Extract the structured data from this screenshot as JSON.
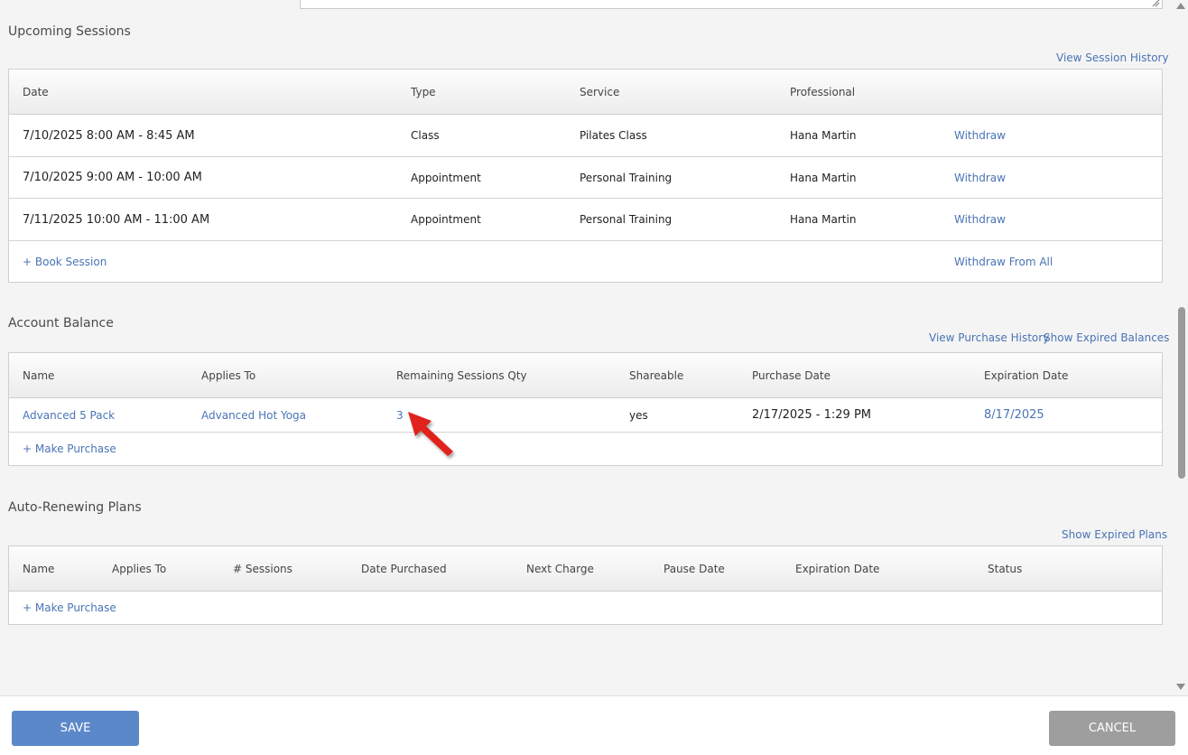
{
  "upcoming": {
    "title": "Upcoming Sessions",
    "history_link": "View Session History",
    "columns": [
      "Date",
      "Type",
      "Service",
      "Professional"
    ],
    "rows": [
      {
        "date": "7/10/2025 8:00 AM - 8:45 AM",
        "type": "Class",
        "service": "Pilates Class",
        "professional": "Hana Martin",
        "action": "Withdraw"
      },
      {
        "date": "7/10/2025 9:00 AM - 10:00 AM",
        "type": "Appointment",
        "service": "Personal Training",
        "professional": "Hana Martin",
        "action": "Withdraw"
      },
      {
        "date": "7/11/2025 10:00 AM - 11:00 AM",
        "type": "Appointment",
        "service": "Personal Training",
        "professional": "Hana Martin",
        "action": "Withdraw"
      }
    ],
    "book_link": "+ Book Session",
    "withdraw_all_link": "Withdraw From All"
  },
  "balance": {
    "title": "Account Balance",
    "purchase_history_link": "View Purchase History",
    "expired_link": "Show Expired Balances",
    "columns": [
      "Name",
      "Applies To",
      "Remaining Sessions Qty",
      "Shareable",
      "Purchase Date",
      "Expiration Date"
    ],
    "rows": [
      {
        "name": "Advanced 5 Pack",
        "applies_to": "Advanced Hot Yoga",
        "remaining": "3",
        "shareable": "yes",
        "purchase_date": "2/17/2025 - 1:29 PM",
        "expiration_date": "8/17/2025"
      }
    ],
    "purchase_link": "+ Make Purchase"
  },
  "plans": {
    "title": "Auto-Renewing Plans",
    "expired_link": "Show Expired Plans",
    "columns": [
      "Name",
      "Applies To",
      "# Sessions",
      "Date Purchased",
      "Next Charge",
      "Pause Date",
      "Expiration Date",
      "Status"
    ],
    "purchase_link": "+ Make Purchase"
  },
  "footer": {
    "save_label": "SAVE",
    "cancel_label": "CANCEL"
  },
  "colors": {
    "link": "#4a74b5",
    "save_button": "#5b88c9",
    "cancel_button": "#9e9e9e",
    "annotation_arrow": "#e0201b"
  },
  "icons": [
    "resize-grip-icon",
    "scroll-up-icon",
    "scroll-down-icon",
    "annotation-arrow-icon"
  ]
}
